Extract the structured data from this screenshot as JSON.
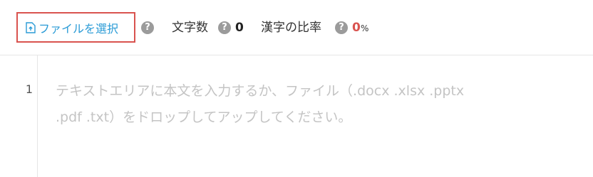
{
  "toolbar": {
    "file_select_label": "ファイルを選択",
    "char_count_label": "文字数",
    "char_count_value": "0",
    "kanji_ratio_label": "漢字の比率",
    "kanji_ratio_value": "0",
    "kanji_ratio_unit": "%",
    "help_glyph": "?"
  },
  "editor": {
    "line_number": "1",
    "placeholder_line1": "テキストエリアに本文を入力するか、ファイル（.docx .xlsx .pptx",
    "placeholder_line2": ".pdf .txt）をドロップしてアップしてください。"
  },
  "colors": {
    "accent_blue": "#2a9bd6",
    "highlight_red": "#d9534f",
    "help_gray": "#9b9b9b",
    "placeholder_gray": "#c4c4c4"
  },
  "icons": {
    "file_select": "file-upload-icon",
    "help": "question-circle-icon"
  }
}
